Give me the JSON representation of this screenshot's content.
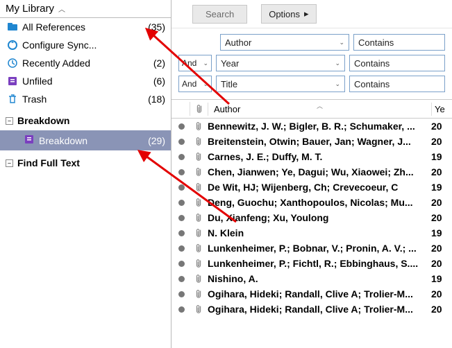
{
  "sidebar": {
    "header": "My Library",
    "items": [
      {
        "label": "All References",
        "count": "(35)"
      },
      {
        "label": "Configure Sync...",
        "count": ""
      },
      {
        "label": "Recently Added",
        "count": "(2)"
      },
      {
        "label": "Unfiled",
        "count": "(6)"
      },
      {
        "label": "Trash",
        "count": "(18)"
      }
    ],
    "groups": [
      {
        "label": "Breakdown",
        "children": [
          {
            "label": "Breakdown",
            "count": "(29)",
            "selected": true
          }
        ]
      },
      {
        "label": "Find Full Text",
        "children": []
      }
    ]
  },
  "toolbar": {
    "search_label": "Search",
    "options_label": "Options"
  },
  "search_rows": [
    {
      "bool": "",
      "field": "Author",
      "cond": "Contains"
    },
    {
      "bool": "And",
      "field": "Year",
      "cond": "Contains"
    },
    {
      "bool": "And",
      "field": "Title",
      "cond": "Contains"
    }
  ],
  "columns": {
    "author": "Author",
    "year": "Ye"
  },
  "refs": [
    {
      "author": "Bennewitz, J. W.; Bigler, B. R.; Schumaker, ...",
      "year": "20"
    },
    {
      "author": "Breitenstein, Otwin; Bauer, Jan; Wagner, J...",
      "year": "20"
    },
    {
      "author": "Carnes, J. E.; Duffy, M. T.",
      "year": "19"
    },
    {
      "author": "Chen, Jianwen; Ye, Dagui; Wu, Xiaowei; Zh...",
      "year": "20"
    },
    {
      "author": "De Wit, HJ; Wijenberg, Ch; Crevecoeur, C",
      "year": "19"
    },
    {
      "author": "Deng, Guochu; Xanthopoulos, Nicolas; Mu...",
      "year": "20"
    },
    {
      "author": "Du, Xianfeng; Xu, Youlong",
      "year": "20"
    },
    {
      "author": "N. Klein",
      "year": "19"
    },
    {
      "author": "Lunkenheimer, P.; Bobnar, V.; Pronin, A. V.; ...",
      "year": "20"
    },
    {
      "author": "Lunkenheimer, P.; Fichtl, R.; Ebbinghaus, S....",
      "year": "20"
    },
    {
      "author": "Nishino, A.",
      "year": "19"
    },
    {
      "author": "Ogihara, Hideki; Randall, Clive A; Trolier-M...",
      "year": "20"
    },
    {
      "author": "Ogihara, Hideki; Randall, Clive A; Trolier-M...",
      "year": "20"
    }
  ]
}
